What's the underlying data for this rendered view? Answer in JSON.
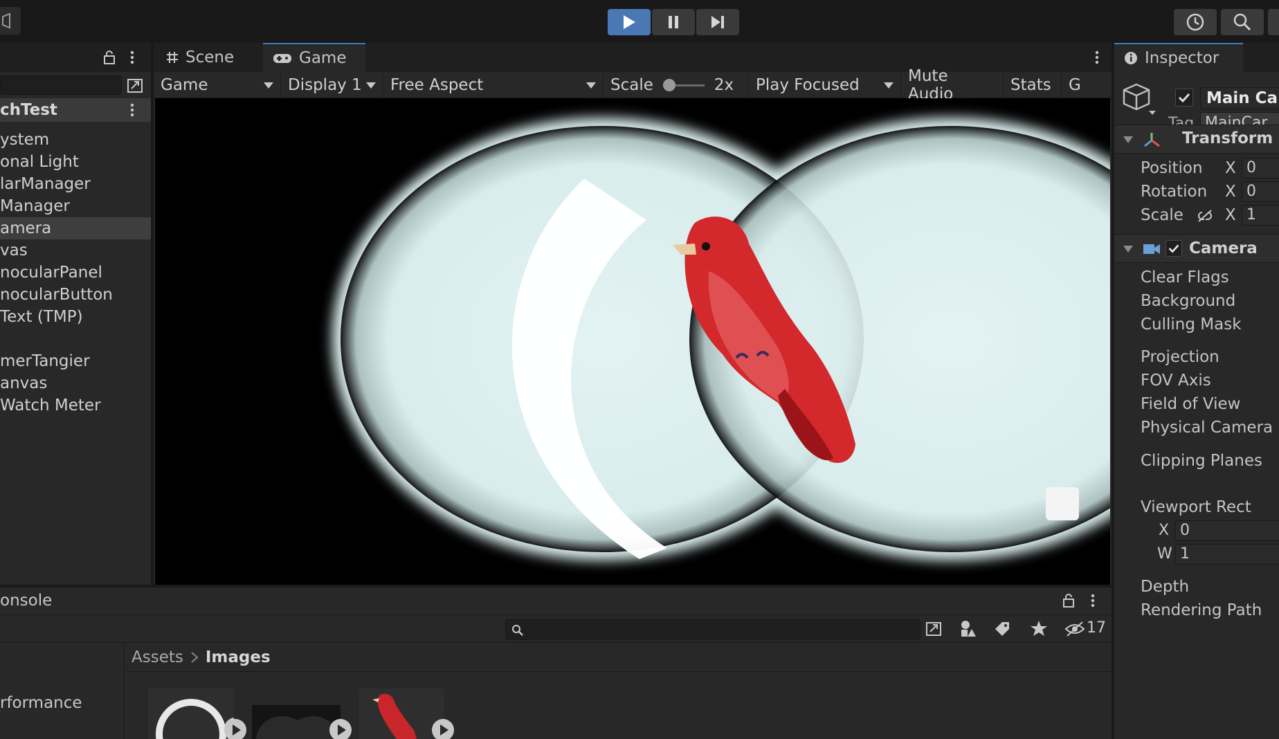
{
  "toolbar": {
    "play": "play-icon",
    "pause": "pause-icon",
    "step": "step-icon",
    "history": "history-icon",
    "search": "search-icon"
  },
  "hierarchy": {
    "scene_name": "chTest",
    "items": [
      "ystem",
      "onal Light",
      "larManager",
      "Manager",
      "amera",
      "vas",
      "nocularPanel",
      "nocularButton",
      " Text (TMP)",
      "merTangier",
      "anvas",
      " Watch Meter"
    ]
  },
  "tabs": {
    "scene": "Scene",
    "game": "Game",
    "inspector": "Inspector",
    "console": "onsole"
  },
  "game_toolbar": {
    "mode": "Game",
    "display": "Display 1",
    "aspect": "Free Aspect",
    "scale_label": "Scale",
    "scale_value": "2x",
    "play_focused": "Play Focused",
    "mute_audio": "Mute Audio",
    "stats": "Stats",
    "gizmos_trunc": "G"
  },
  "inspector": {
    "object_name": "Main Car",
    "tag_label": "Tag",
    "tag_value": "MainCar",
    "transform": {
      "title": "Transform",
      "position": "Position",
      "rotation": "Rotation",
      "scale": "Scale",
      "x_label": "X",
      "pos_x": "0",
      "rot_x": "0",
      "scale_x": "1"
    },
    "camera": {
      "title": "Camera",
      "props": [
        "Clear Flags",
        "Background",
        "Culling Mask",
        "Projection",
        "FOV Axis",
        "Field of View",
        "Physical Camera",
        "Clipping Planes",
        "Viewport Rect"
      ],
      "vp_x_label": "X",
      "vp_x": "0",
      "vp_w_label": "W",
      "vp_w": "1",
      "depth": "Depth",
      "rendering_path": "Rendering Path"
    }
  },
  "project": {
    "breadcrumb_root": "Assets",
    "breadcrumb_current": "Images",
    "hidden_count": "17",
    "left_item": "rformance"
  },
  "colors": {
    "accent": "#4a78b5",
    "bird_red": "#d3282c"
  }
}
